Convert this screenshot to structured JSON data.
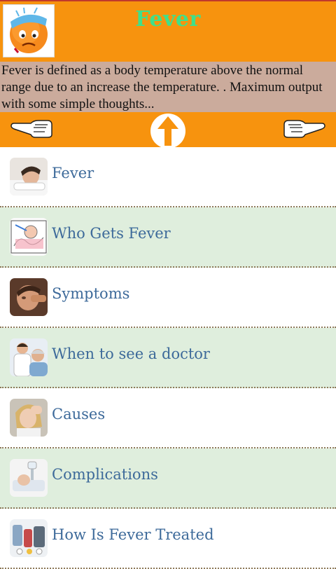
{
  "app": {
    "title": "Fever",
    "description": "Fever is defined as a body temperature above the normal range due to an increase the temperature. . Maximum output with some simple thoughts..."
  },
  "nav": {
    "left_icon": "pointing-hand-left-icon",
    "up_icon": "up-arrow-icon",
    "right_icon": "pointing-hand-right-icon"
  },
  "topics": [
    {
      "label": "Fever",
      "thumb": "sick-person-in-bed-thumbnail"
    },
    {
      "label": "Who Gets Fever",
      "thumb": "baby-thermometer-thumbnail"
    },
    {
      "label": "Symptoms",
      "thumb": "sick-man-thumbnail"
    },
    {
      "label": "When to see a doctor",
      "thumb": "doctor-patient-thumbnail"
    },
    {
      "label": "Causes",
      "thumb": "woman-headache-thumbnail"
    },
    {
      "label": "Complications",
      "thumb": "hospital-patient-thumbnail"
    },
    {
      "label": "How Is Fever Treated",
      "thumb": "medicines-thumbnail"
    }
  ],
  "colors": {
    "header": "#f7930e",
    "title": "#3fe08a",
    "description_bg": "#cbab9c",
    "alt_row": "#dfeedd",
    "link_text": "#3d6a9a"
  }
}
